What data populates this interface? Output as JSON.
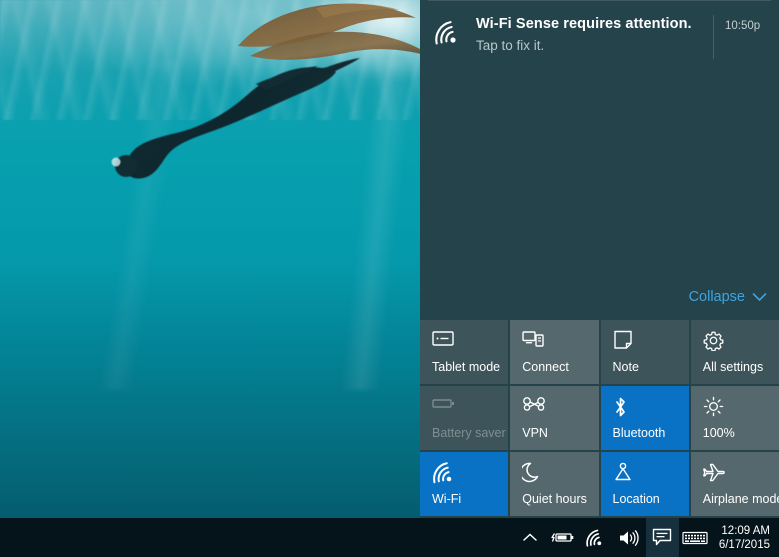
{
  "desktop": {
    "wallpaper_description": "underwater freediver with fins near ocean surface",
    "wallpaper_colors": {
      "water_top": "#3ca6b4",
      "water_bottom": "#046b7e",
      "diver_silhouette": "#0f2a30"
    }
  },
  "action_center": {
    "background_color": "#25434a",
    "notifications": [
      {
        "icon": "wifi-sense-icon",
        "title": "Wi-Fi Sense requires attention.",
        "subtitle": "Tap to fix it.",
        "time": "10:50p"
      }
    ],
    "collapse": {
      "label": "Collapse",
      "icon": "chevron-down-icon",
      "color": "#3fa3e0"
    },
    "quick_actions": [
      {
        "label": "Tablet mode",
        "icon": "tablet-mode-icon",
        "state": "off",
        "name": "tablet-mode"
      },
      {
        "label": "Connect",
        "icon": "connect-icon",
        "state": "off",
        "name": "connect"
      },
      {
        "label": "Note",
        "icon": "note-icon",
        "state": "off",
        "name": "note"
      },
      {
        "label": "All settings",
        "icon": "gear-icon",
        "state": "off",
        "name": "all-settings"
      },
      {
        "label": "Battery saver",
        "icon": "battery-icon",
        "state": "disabled",
        "name": "battery-saver"
      },
      {
        "label": "VPN",
        "icon": "vpn-icon",
        "state": "inactive",
        "name": "vpn"
      },
      {
        "label": "Bluetooth",
        "icon": "bluetooth-icon",
        "state": "on",
        "name": "bluetooth"
      },
      {
        "label": "100%",
        "icon": "brightness-icon",
        "state": "inactive",
        "name": "brightness"
      },
      {
        "label": "Wi-Fi",
        "icon": "wifi-icon",
        "state": "on",
        "name": "wifi"
      },
      {
        "label": "Quiet hours",
        "icon": "moon-icon",
        "state": "inactive",
        "name": "quiet-hours"
      },
      {
        "label": "Location",
        "icon": "location-icon",
        "state": "on",
        "name": "location"
      },
      {
        "label": "Airplane mode",
        "icon": "airplane-icon",
        "state": "inactive",
        "name": "airplane-mode"
      }
    ],
    "accent_color": "#0a72c4",
    "tile_color": "#55686d",
    "tile_dim_color": "#3c545a"
  },
  "taskbar": {
    "background_color": "#05131b",
    "tray_icons": [
      {
        "name": "show-hidden-icons-icon",
        "glyph": "chevron-up"
      },
      {
        "name": "battery-charging-icon",
        "glyph": "battery"
      },
      {
        "name": "network-wifi-icon",
        "glyph": "wifi"
      },
      {
        "name": "volume-icon",
        "glyph": "speaker"
      },
      {
        "name": "action-center-icon",
        "glyph": "comment"
      },
      {
        "name": "touch-keyboard-icon",
        "glyph": "keyboard"
      }
    ],
    "clock": {
      "time": "12:09 AM",
      "date": "6/17/2015"
    }
  }
}
